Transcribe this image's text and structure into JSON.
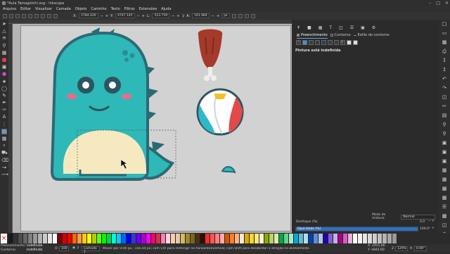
{
  "window": {
    "title": "*Aula Tamagotchi.svg - Inkscape"
  },
  "menu": [
    "Arquivo",
    "Editar",
    "Visualizar",
    "Camada",
    "Objeto",
    "Caminho",
    "Texto",
    "Filtros",
    "Extensões",
    "Ajuda"
  ],
  "ctrlbar": {
    "x_label": "X:",
    "x": "2784.426",
    "y_label": "Y:",
    "y": "4747.145",
    "w_label": "L:",
    "w": "523.759",
    "h_label": "A:",
    "h": "161.964",
    "unit": "px"
  },
  "tabs": [
    {
      "label": "Preenchimento",
      "active": true
    },
    {
      "label": "Contorno",
      "active": false
    },
    {
      "label": "Estilo do contorno",
      "active": false
    }
  ],
  "paint": {
    "none_label": "Pintura está indefinida"
  },
  "blend": {
    "label": "Modo de mistura:",
    "value": "Normal"
  },
  "blur": {
    "label": "Desfoque (%)",
    "value": "0.0"
  },
  "opacity": {
    "label": "Opacidade (%)",
    "value": "100.0"
  },
  "status": {
    "fill_label": "Preenchimento:",
    "fill_value": "Indefinido",
    "stroke_label": "Contorno:",
    "stroke_value": "Indefinido",
    "opacity_label": "O:",
    "opacity_value": "100",
    "layer": "Camada 1",
    "message": "Mover por 0.00 px, -156.44 px; com Ctrl para restringir no horizontal/vertical; com Shift para desabilitar a atração no alinhamento",
    "x_label": "X:",
    "x": "2925.86",
    "y_label": "Y:",
    "y": "4844.80",
    "zoom_label": "Z:",
    "zoom": "129%",
    "rotation_label": "R:",
    "rotation": "0.00°"
  },
  "palette": [
    "#1a1a1a",
    "#333333",
    "#4d4d4d",
    "#666666",
    "#808080",
    "#999999",
    "#b3b3b3",
    "#cccccc",
    "#e6e6e6",
    "#ffffff",
    "#800000",
    "#d40000",
    "#ff0000",
    "#ff6600",
    "#ff9955",
    "#ffcc00",
    "#ffff00",
    "#aad400",
    "#66ff00",
    "#00ff00",
    "#00d455",
    "#00ffcc",
    "#00ccff",
    "#0066ff",
    "#0000ff",
    "#3737c8",
    "#6600ff",
    "#aa00d4",
    "#ff00ff",
    "#ff0066",
    "#c8374d",
    "#ff80b2",
    "#ffd5e5",
    "#ffccaa",
    "#e9c6af",
    "#d3bc5f",
    "#a0892c",
    "#786721",
    "#502d16",
    "#2b1100",
    "#ff2a2a",
    "#ff5555",
    "#ff8080",
    "#ffaaaa",
    "#d45500",
    "#ff7f2a",
    "#ffb380",
    "#ffe6d5",
    "#d4aa00",
    "#ffd42a",
    "#ffe680",
    "#fff6d5",
    "#88aa00",
    "#bcd35f",
    "#dde9af",
    "#00aa44",
    "#5fd38d",
    "#afe9c6",
    "#00aad4",
    "#5fbcd3",
    "#afdde9",
    "#0044aa",
    "#5f8dd3",
    "#afc6e9",
    "#2200aa",
    "#7f5fd3",
    "#c6afe9",
    "#aa0088",
    "#d35fbc",
    "#e9afdd",
    "#ffffff",
    "#f2f2f2",
    "#e6e6e6",
    "#d9d9d9",
    "#cccccc",
    "#bfbfbf",
    "#b3b3b3",
    "#a6a6a6",
    "#999999"
  ]
}
